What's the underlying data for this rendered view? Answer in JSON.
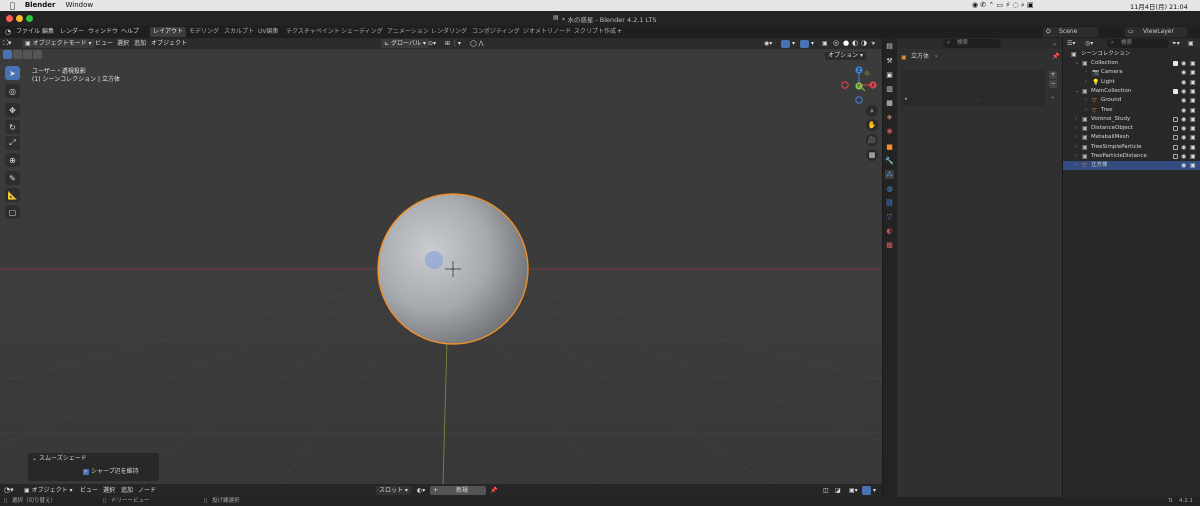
{
  "mac": {
    "apple_icon": "apple-icon",
    "app_name": "Blender",
    "window_menu": "Window",
    "clock": "11月4日(月) 21:04"
  },
  "title": {
    "text": "* 水の惑星 - Blender 4.2.1 LTS"
  },
  "topbar": {
    "menus": [
      "ファイル",
      "編集",
      "レンダー",
      "ウィンドウ",
      "ヘルプ"
    ],
    "workspaces": [
      "レイアウト",
      "モデリング",
      "スカルプト",
      "UV編集",
      "テクスチャペイント",
      "シェーディング",
      "アニメーション",
      "レンダリング",
      "コンポジティング",
      "ジオメトリノード",
      "スクリプト作成"
    ],
    "active_workspace": "レイアウト",
    "add_tab": "+",
    "scene": "Scene",
    "view_layer": "ViewLayer"
  },
  "viewport_header": {
    "mode": "オブジェクトモード",
    "menus": [
      "ビュー",
      "選択",
      "追加",
      "オブジェクト"
    ],
    "transform_orientation": "グローバル",
    "options": "オプション"
  },
  "viewport": {
    "overlay_line1": "ユーザー・透視投影",
    "overlay_line2": "(1) シーンコレクション | 立方体",
    "gizmo_x": "X",
    "gizmo_y": "Y",
    "gizmo_z": "Z"
  },
  "smooth_panel": {
    "title": "スムーズシェード",
    "checkbox_label": "シャープ辺を維持",
    "checkbox_checked": true
  },
  "bottombar": {
    "mode": "オブジェクト",
    "menus": [
      "ビュー",
      "選択",
      "追加",
      "ノード"
    ],
    "slot": "スロット",
    "new_button": "新規"
  },
  "statusbar": {
    "select": "選択（切り替え）",
    "pan": "ドリーービュー",
    "context": "投げ縄選択",
    "version": "4.2.1"
  },
  "properties": {
    "search_placeholder": "検索",
    "object_name": "立方体"
  },
  "outliner": {
    "search_placeholder": "検索",
    "root": "シーンコレクション",
    "rows": [
      {
        "name": "Collection",
        "indent": 1,
        "icon": "collection-icon",
        "expanded": true,
        "checkbox": true
      },
      {
        "name": "Camera",
        "indent": 2,
        "icon": "camera-icon",
        "expanded": false,
        "checkbox": false
      },
      {
        "name": "Light",
        "indent": 2,
        "icon": "light-icon",
        "expanded": false,
        "checkbox": false
      },
      {
        "name": "MainCollection",
        "indent": 1,
        "icon": "collection-icon",
        "expanded": true,
        "checkbox": true
      },
      {
        "name": "Ground",
        "indent": 2,
        "icon": "mesh-icon",
        "expanded": false,
        "checkbox": false
      },
      {
        "name": "Tree",
        "indent": 2,
        "icon": "mesh-icon",
        "expanded": false,
        "checkbox": false
      },
      {
        "name": "Voronoi_Study",
        "indent": 1,
        "icon": "collection-icon",
        "expanded": false,
        "checkbox": true
      },
      {
        "name": "DistanceObject",
        "indent": 1,
        "icon": "collection-icon",
        "expanded": false,
        "checkbox": true
      },
      {
        "name": "MetaballMesh",
        "indent": 1,
        "icon": "collection-icon",
        "expanded": false,
        "checkbox": true
      },
      {
        "name": "TreeSimpleParticle",
        "indent": 1,
        "icon": "collection-icon",
        "expanded": false,
        "checkbox": true
      },
      {
        "name": "TreeParticleDistance",
        "indent": 1,
        "icon": "collection-icon",
        "expanded": false,
        "checkbox": true
      },
      {
        "name": "立方体",
        "indent": 1,
        "icon": "mesh-icon",
        "expanded": false,
        "checkbox": false,
        "selected": true
      }
    ]
  },
  "colors": {
    "accent": "#4772b3",
    "selection_outline": "#f28f26",
    "x_axis": "#e0474f",
    "y_axis": "#8bc34a",
    "z_axis": "#3f83d9"
  }
}
